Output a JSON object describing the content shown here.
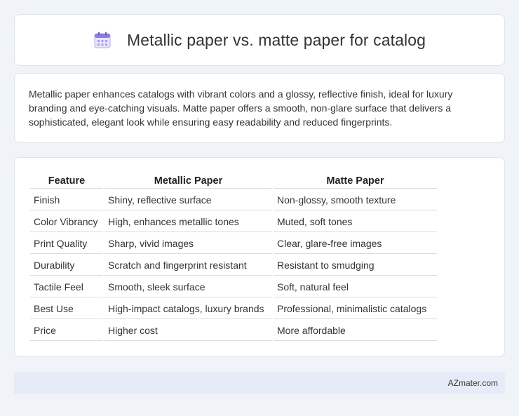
{
  "header": {
    "title": "Metallic paper vs. matte paper for catalog",
    "icon": "calendar-icon"
  },
  "intro": {
    "text": "Metallic paper enhances catalogs with vibrant colors and a glossy, reflective finish, ideal for luxury branding and eye-catching visuals. Matte paper offers a smooth, non-glare surface that delivers a sophisticated, elegant look while ensuring easy readability and reduced fingerprints."
  },
  "table": {
    "headers": [
      "Feature",
      "Metallic Paper",
      "Matte Paper"
    ],
    "rows": [
      [
        "Finish",
        "Shiny, reflective surface",
        "Non-glossy, smooth texture"
      ],
      [
        "Color Vibrancy",
        "High, enhances metallic tones",
        "Muted, soft tones"
      ],
      [
        "Print Quality",
        "Sharp, vivid images",
        "Clear, glare-free images"
      ],
      [
        "Durability",
        "Scratch and fingerprint resistant",
        "Resistant to smudging"
      ],
      [
        "Tactile Feel",
        "Smooth, sleek surface",
        "Soft, natural feel"
      ],
      [
        "Best Use",
        "High-impact catalogs, luxury brands",
        "Professional, minimalistic catalogs"
      ],
      [
        "Price",
        "Higher cost",
        "More affordable"
      ]
    ]
  },
  "footer": {
    "text": "AZmater.com"
  },
  "colors": {
    "background": "#f0f3f8",
    "card": "#ffffff",
    "footer": "#e6ecf7",
    "icon_accent": "#7b6fd6"
  }
}
